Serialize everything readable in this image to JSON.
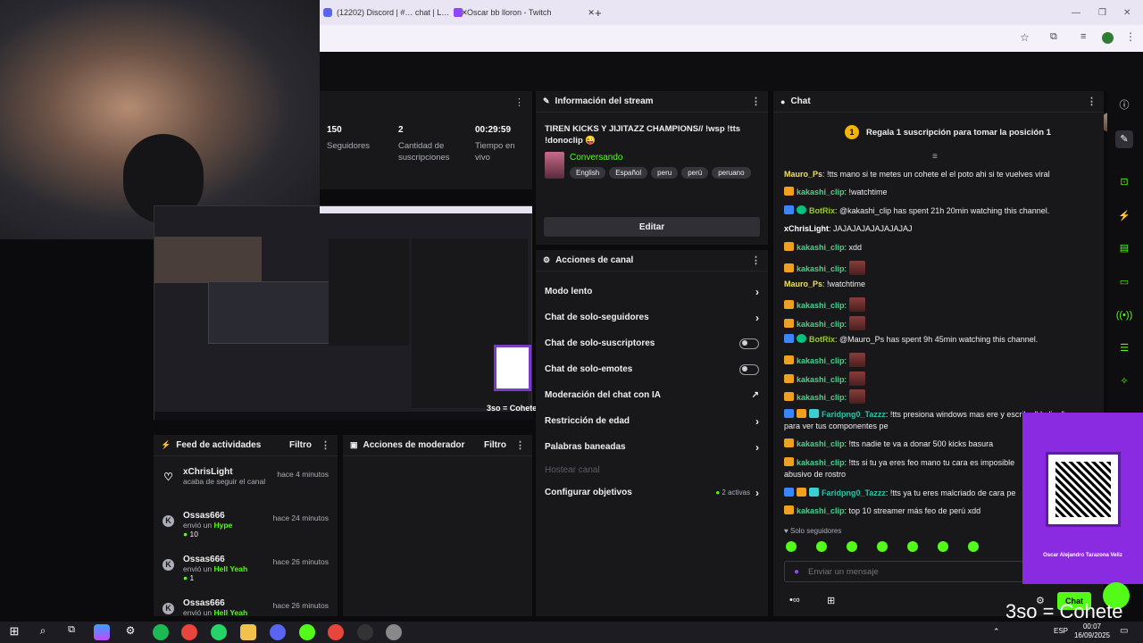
{
  "browser": {
    "tabs": [
      {
        "title": "(12202) Discord | #… chat | L…"
      },
      {
        "title": "Oscar bb lloron - Twitch"
      }
    ]
  },
  "stats": [
    {
      "value": "150",
      "label": "Seguidores"
    },
    {
      "value": "2",
      "label": "Cantidad de suscripciones"
    },
    {
      "value": "00:29:59",
      "label": "Tiempo en vivo"
    }
  ],
  "stream_info": {
    "header": "Información del stream",
    "title": "TIREN KICKS Y JIJITAZZ CHAMPIONS// !wsp !tts !donoclip 😜",
    "category": "Conversando",
    "tags": [
      "English",
      "Español",
      "peru",
      "perú",
      "peruano"
    ],
    "edit_label": "Editar"
  },
  "channel_actions": {
    "header": "Acciones de canal",
    "items": [
      {
        "label": "Modo lento",
        "control": "chevron"
      },
      {
        "label": "Chat de solo-seguidores",
        "control": "chevron"
      },
      {
        "label": "Chat de solo-suscriptores",
        "control": "toggle"
      },
      {
        "label": "Chat de solo-emotes",
        "control": "toggle"
      },
      {
        "label": "Moderación del chat con IA",
        "control": "external"
      },
      {
        "label": "Restricción de edad",
        "control": "chevron"
      },
      {
        "label": "Palabras baneadas",
        "control": "chevron"
      },
      {
        "label": "Hostear canal",
        "control": "none"
      },
      {
        "label": "Configurar objetivos",
        "control": "chevron",
        "badge": "2 activas"
      }
    ]
  },
  "activity_feed": {
    "header": "Feed de actividades",
    "filter": "Filtro",
    "items": [
      {
        "name": "xChrisLight",
        "time": "hace 4 minutos",
        "desc": "acaba de seguir el canal",
        "icon": "heart-icon"
      },
      {
        "name": "Ossas666",
        "time": "hace 24 minutos",
        "desc": "envió un",
        "item": "Hype",
        "count": "10",
        "icon": "kick-icon"
      },
      {
        "name": "Ossas666",
        "time": "hace 26 minutos",
        "desc": "envió un",
        "item": "Hell Yeah",
        "count": "1",
        "icon": "kick-icon"
      },
      {
        "name": "Ossas666",
        "time": "hace 26 minutos",
        "desc": "envió un",
        "item": "Hell Yeah",
        "icon": "kick-icon"
      }
    ]
  },
  "mod_actions": {
    "header": "Acciones de moderador",
    "filter": "Filtro"
  },
  "chat": {
    "header": "Chat",
    "pinned": {
      "rank": "1",
      "text": "Regala 1 suscripción para tomar la posición 1"
    },
    "messages": [
      {
        "user": "Mauro_Ps",
        "text": ": !tts mano si te metes un cohete el el poto ahi si te vuelves viral"
      },
      {
        "user": "kakashi_clip",
        "text": ": !watchtime"
      },
      {
        "user": "BotRix",
        "text": ": @kakashi_clip has spent 21h 20min watching this channel."
      },
      {
        "user": "xChrisLight",
        "text": ": JAJAJAJAJAJAJAJAJ"
      },
      {
        "user": "kakashi_clip",
        "text": ": xdd"
      },
      {
        "user": "kakashi_clip",
        "text": ":"
      },
      {
        "user": "Mauro_Ps",
        "text": ": !watchtime"
      },
      {
        "user": "kakashi_clip",
        "text": ":"
      },
      {
        "user": "kakashi_clip",
        "text": ":"
      },
      {
        "user": "BotRix",
        "text": ": @Mauro_Ps has spent 9h 45min watching this channel."
      },
      {
        "user": "kakashi_clip",
        "text": ":"
      },
      {
        "user": "kakashi_clip",
        "text": ":"
      },
      {
        "user": "kakashi_clip",
        "text": ":"
      },
      {
        "user": "Faridpng0_Tazzz",
        "text": ": !tts presiona windows mas ere y escribe \"dxdiag\"",
        "cont": "para ver tus componentes pe"
      },
      {
        "user": "kakashi_clip",
        "text": ": !tts nadie te va a donar 500 kicks basura"
      },
      {
        "user": "kakashi_clip",
        "text": ": !tts si tu ya eres feo mano tu cara es imposible",
        "cont": "abusivo de rostro"
      },
      {
        "user": "Faridpng0_Tazzz",
        "text": ": !tts ya tu eres malcriado de cara pe"
      },
      {
        "user": "kakashi_clip",
        "text": ": top 10 streamer más feo de perú xdd"
      }
    ],
    "mode": "Solo seguidores",
    "input_placeholder": "Enviar un mensaje",
    "send_label": "Chat"
  },
  "overlay": {
    "caption": "3so = Cohete",
    "qr_name": "Oscar Alejandro Tarazona Veliz"
  },
  "taskbar": {
    "lang": "ESP",
    "time": "00:07",
    "date": "16/09/2025"
  }
}
